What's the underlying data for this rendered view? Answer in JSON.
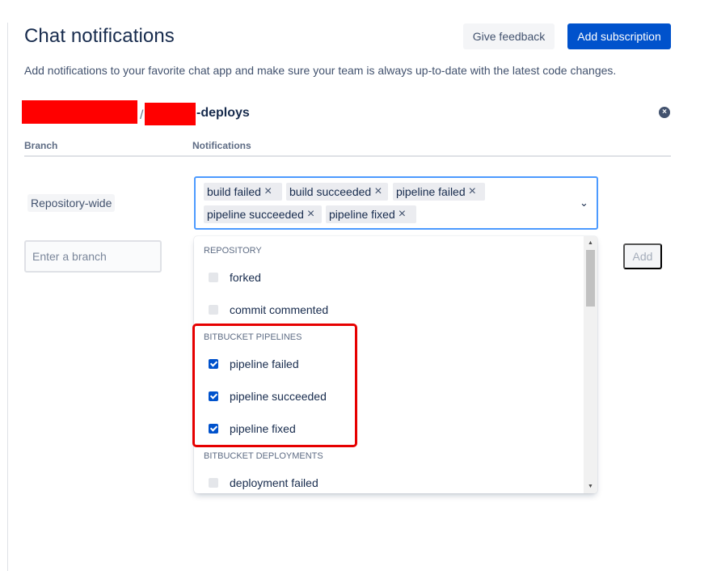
{
  "header": {
    "title": "Chat notifications",
    "feedback_label": "Give feedback",
    "add_subscription_label": "Add subscription",
    "description": "Add notifications to your favorite chat app and make sure your team is always up-to-date with the latest code changes."
  },
  "subscription": {
    "separator": "/",
    "repo_suffix": "-deploys",
    "close_glyph": "×",
    "columns": {
      "branch": "Branch",
      "notifications": "Notifications"
    },
    "scope_label": "Repository-wide",
    "selected_chips": [
      "build failed",
      "build succeeded",
      "pipeline failed",
      "pipeline succeeded",
      "pipeline fixed"
    ],
    "chip_remove_glyph": "×",
    "chevron_glyph": "⌄",
    "branch_placeholder": "Enter a branch",
    "add_label": "Add"
  },
  "dropdown": {
    "groups": [
      {
        "heading": "Repository",
        "options": [
          {
            "label": "forked",
            "checked": false
          },
          {
            "label": "commit commented",
            "checked": false
          }
        ]
      },
      {
        "heading": "Bitbucket Pipelines",
        "options": [
          {
            "label": "pipeline failed",
            "checked": true
          },
          {
            "label": "pipeline succeeded",
            "checked": true
          },
          {
            "label": "pipeline fixed",
            "checked": true
          }
        ]
      },
      {
        "heading": "Bitbucket Deployments",
        "options": [
          {
            "label": "deployment failed",
            "checked": false
          }
        ]
      }
    ],
    "scroll_up_glyph": "▲",
    "scroll_down_glyph": "▼"
  },
  "colors": {
    "primary": "#0052cc",
    "focus_border": "#4c9aff",
    "highlight": "#e60000",
    "redaction": "#ff0000"
  }
}
